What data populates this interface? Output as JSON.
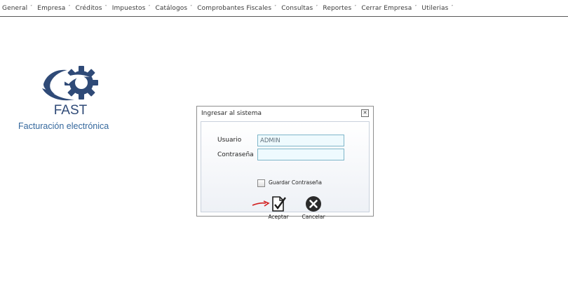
{
  "menu": {
    "items": [
      {
        "label": "General"
      },
      {
        "label": "Empresa"
      },
      {
        "label": "Créditos"
      },
      {
        "label": "Impuestos"
      },
      {
        "label": "Catálogos"
      },
      {
        "label": "Comprobantes Fiscales"
      },
      {
        "label": "Consultas"
      },
      {
        "label": "Reportes"
      },
      {
        "label": "Cerrar Empresa"
      },
      {
        "label": "Utilerias"
      }
    ],
    "arrow": "˅"
  },
  "logo": {
    "name": "FAST",
    "tagline": "Facturación electrónica",
    "gear_color": "#2f4a77"
  },
  "login_dialog": {
    "title": "Ingresar al sistema",
    "close_glyph": "✕",
    "user_label": "Usuario",
    "user_value": "ADMIN",
    "password_label": "Contraseña",
    "password_value": "",
    "remember_label": "Guardar Contraseña",
    "remember_checked": false,
    "accept_label": "Aceptar",
    "cancel_label": "Cancelar"
  },
  "icons": {
    "accept": "document-check-icon",
    "cancel": "close-circle-icon",
    "pointer": "red-arrow-icon"
  },
  "colors": {
    "brand": "#2f4a77",
    "input_border": "#7fb6c9",
    "pointer_arrow": "#d21f1f"
  }
}
